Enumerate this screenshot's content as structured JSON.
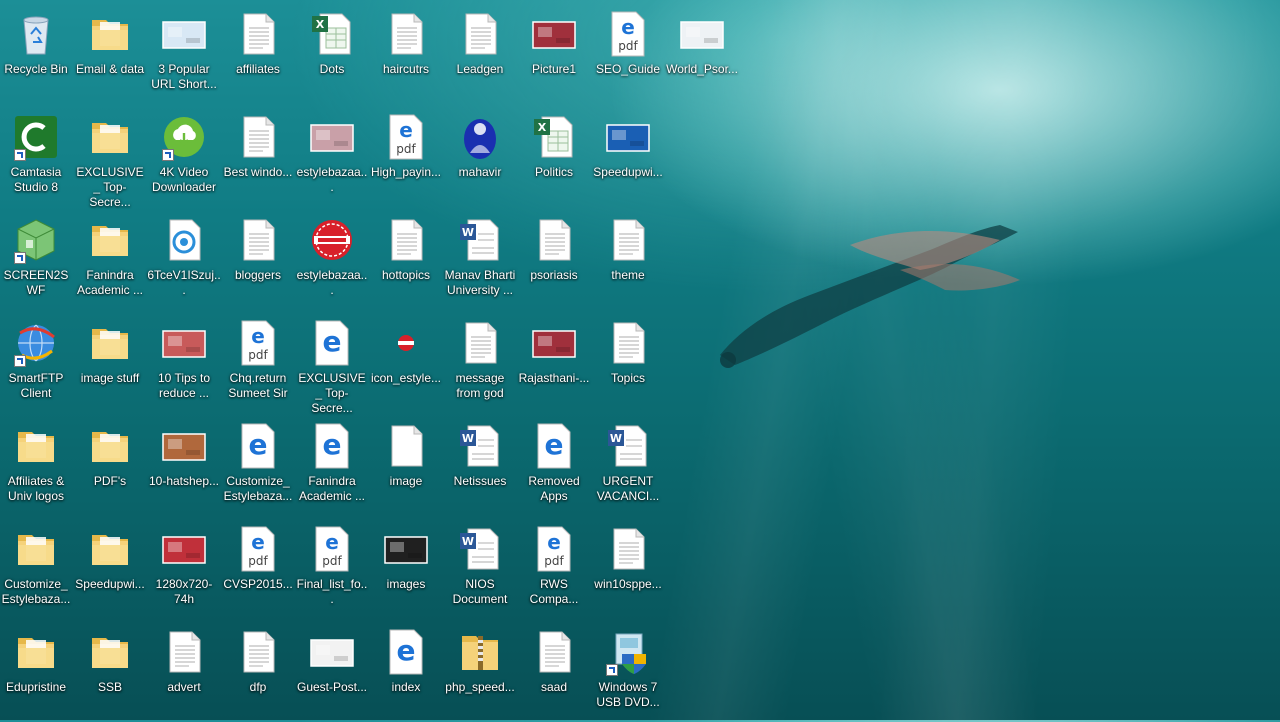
{
  "desktop": {
    "icons": [
      {
        "label": "Recycle Bin",
        "icon": "recycle-bin-icon",
        "type": "recycle"
      },
      {
        "label": "Email & data",
        "icon": "folder-icon",
        "type": "folder"
      },
      {
        "label": "3 Popular URL Short...",
        "icon": "image-thumbnail-icon",
        "type": "thumb",
        "color": "#d8e8f5"
      },
      {
        "label": "affiliates",
        "icon": "text-document-icon",
        "type": "doc"
      },
      {
        "label": "Dots",
        "icon": "excel-document-icon",
        "type": "excel"
      },
      {
        "label": "haircutrs",
        "icon": "text-document-icon",
        "type": "doc"
      },
      {
        "label": "Leadgen",
        "icon": "text-document-icon",
        "type": "doc"
      },
      {
        "label": "Picture1",
        "icon": "image-thumbnail-icon",
        "type": "thumb",
        "color": "#a0303c"
      },
      {
        "label": "SEO_Guide",
        "icon": "edge-pdf-icon",
        "type": "pdf"
      },
      {
        "label": "World_Psor...",
        "icon": "image-thumbnail-icon",
        "type": "thumb",
        "color": "#eef2f5"
      },
      {
        "label": "Camtasia Studio 8",
        "icon": "camtasia-icon",
        "type": "camtasia"
      },
      {
        "label": "EXCLUSIVE_ Top-Secre...",
        "icon": "folder-icon",
        "type": "folder"
      },
      {
        "label": "4K Video Downloader",
        "icon": "download-icon",
        "type": "download"
      },
      {
        "label": "Best windo...",
        "icon": "text-document-icon",
        "type": "doc"
      },
      {
        "label": "estylebazaa...",
        "icon": "image-thumbnail-icon",
        "type": "thumb",
        "color": "#c9a0a8"
      },
      {
        "label": "High_payin...",
        "icon": "edge-pdf-icon",
        "type": "pdf"
      },
      {
        "label": "mahavir",
        "icon": "mahavir-image-icon",
        "type": "mahavir"
      },
      {
        "label": "Politics",
        "icon": "excel-document-icon",
        "type": "excel"
      },
      {
        "label": "Speedupwi...",
        "icon": "image-thumbnail-icon",
        "type": "thumb",
        "color": "#1a5fb4"
      },
      {
        "label": "SCREEN2SWF",
        "icon": "screen2swf-icon",
        "type": "greenbox"
      },
      {
        "label": "Fanindra Academic ...",
        "icon": "folder-icon",
        "type": "folder"
      },
      {
        "label": "6TceV1ISzuj...",
        "icon": "target-document-icon",
        "type": "target"
      },
      {
        "label": "bloggers",
        "icon": "text-document-icon",
        "type": "doc"
      },
      {
        "label": "estylebazaa...",
        "icon": "estylebazaar-logo-icon",
        "type": "redlogo"
      },
      {
        "label": "hottopics",
        "icon": "text-document-icon",
        "type": "doc"
      },
      {
        "label": "Manav Bharti University ...",
        "icon": "word-document-icon",
        "type": "word"
      },
      {
        "label": "psoriasis",
        "icon": "text-document-icon",
        "type": "doc"
      },
      {
        "label": "theme",
        "icon": "text-document-icon",
        "type": "doc"
      },
      {
        "label": "SmartFTP Client",
        "icon": "smartftp-icon",
        "type": "globe"
      },
      {
        "label": "image stuff",
        "icon": "folder-icon",
        "type": "folder"
      },
      {
        "label": "10 Tips to reduce ...",
        "icon": "image-thumbnail-icon",
        "type": "thumb",
        "color": "#c85a5a"
      },
      {
        "label": "Chq.return Sumeet Sir",
        "icon": "edge-pdf-icon",
        "type": "pdf"
      },
      {
        "label": "EXCLUSIVE_ Top-Secre...",
        "icon": "edge-document-icon",
        "type": "edge"
      },
      {
        "label": "icon_estyle...",
        "icon": "small-logo-icon",
        "type": "smalllogo"
      },
      {
        "label": "message from god",
        "icon": "text-document-icon",
        "type": "doc"
      },
      {
        "label": "Rajasthani-...",
        "icon": "image-thumbnail-icon",
        "type": "thumb",
        "color": "#a0303c"
      },
      {
        "label": "Topics",
        "icon": "text-document-icon",
        "type": "doc"
      },
      {
        "label": "Affiliates & Univ logos",
        "icon": "folder-icon",
        "type": "folder"
      },
      {
        "label": "PDF's",
        "icon": "folder-icon",
        "type": "folder"
      },
      {
        "label": "10-hatshep...",
        "icon": "image-thumbnail-icon",
        "type": "thumb",
        "color": "#b0683c"
      },
      {
        "label": "Customize_ Estylebaza...",
        "icon": "edge-document-icon",
        "type": "edge"
      },
      {
        "label": "Fanindra Academic ...",
        "icon": "edge-document-icon",
        "type": "edge"
      },
      {
        "label": "image",
        "icon": "blank-document-icon",
        "type": "blank"
      },
      {
        "label": "Netissues",
        "icon": "word-document-icon",
        "type": "word"
      },
      {
        "label": "Removed Apps",
        "icon": "edge-document-icon",
        "type": "edge"
      },
      {
        "label": "URGENT VACANCI...",
        "icon": "word-document-icon",
        "type": "word"
      },
      {
        "label": "Customize_ Estylebaza...",
        "icon": "folder-icon",
        "type": "folder"
      },
      {
        "label": "Speedupwi...",
        "icon": "folder-icon",
        "type": "folder"
      },
      {
        "label": "1280x720-74h",
        "icon": "image-thumbnail-icon",
        "type": "thumb",
        "color": "#c0303a"
      },
      {
        "label": "CVSP2015...",
        "icon": "edge-pdf-icon",
        "type": "pdf"
      },
      {
        "label": "Final_list_fo...",
        "icon": "edge-pdf-icon",
        "type": "pdf"
      },
      {
        "label": "images",
        "icon": "image-thumbnail-icon",
        "type": "thumb",
        "color": "#202020"
      },
      {
        "label": "NIOS Document",
        "icon": "word-document-icon",
        "type": "word"
      },
      {
        "label": "RWS Compa...",
        "icon": "edge-pdf-icon",
        "type": "pdf"
      },
      {
        "label": "win10sppe...",
        "icon": "text-document-icon",
        "type": "doc"
      },
      {
        "label": "Edupristine",
        "icon": "folder-icon",
        "type": "folder"
      },
      {
        "label": "SSB",
        "icon": "folder-icon",
        "type": "folder"
      },
      {
        "label": "advert",
        "icon": "text-document-icon",
        "type": "doc"
      },
      {
        "label": "dfp",
        "icon": "text-document-icon",
        "type": "doc"
      },
      {
        "label": "Guest-Post...",
        "icon": "image-thumbnail-icon",
        "type": "thumb",
        "color": "#f2f2f2"
      },
      {
        "label": "index",
        "icon": "edge-document-icon",
        "type": "edge"
      },
      {
        "label": "php_speed...",
        "icon": "zip-folder-icon",
        "type": "zip"
      },
      {
        "label": "saad",
        "icon": "text-document-icon",
        "type": "doc"
      },
      {
        "label": "Windows 7 USB DVD...",
        "icon": "windows-usb-tool-icon",
        "type": "usbtool"
      }
    ]
  }
}
